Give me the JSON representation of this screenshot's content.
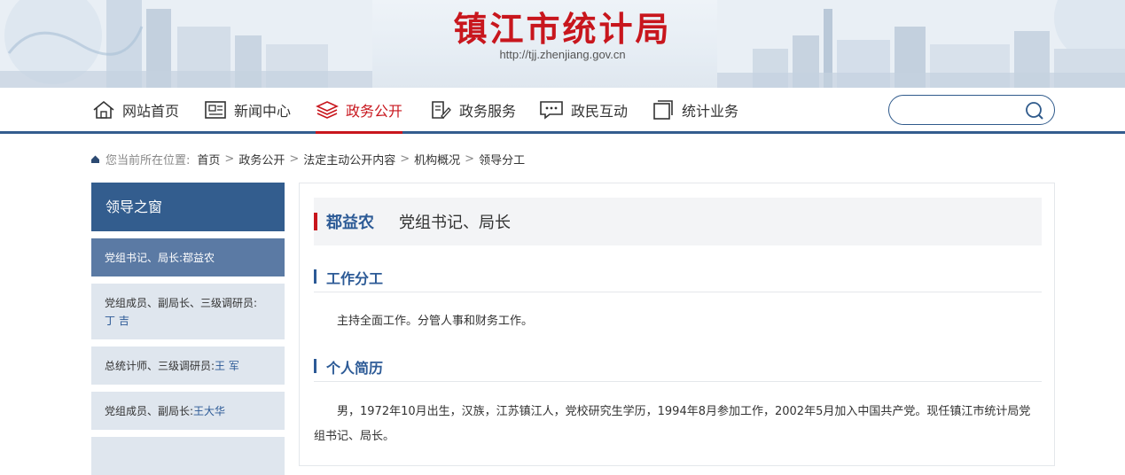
{
  "header": {
    "site_title": "镇江市统计局",
    "site_url": "http://tjj.zhenjiang.gov.cn"
  },
  "nav": {
    "items": [
      {
        "label": "网站首页",
        "icon": "home-icon"
      },
      {
        "label": "新闻中心",
        "icon": "news-icon"
      },
      {
        "label": "政务公开",
        "icon": "layers-icon",
        "active": true
      },
      {
        "label": "政务服务",
        "icon": "edit-document-icon"
      },
      {
        "label": "政民互动",
        "icon": "chat-icon"
      },
      {
        "label": "统计业务",
        "icon": "square-icon"
      }
    ],
    "search_value": "",
    "active_color": "#c8161d",
    "brand_color": "#335d8e"
  },
  "breadcrumb": {
    "label": "您当前所在位置:",
    "items": [
      "首页",
      "政务公开",
      "法定主动公开内容",
      "机构概况",
      "领导分工"
    ],
    "separator": ">"
  },
  "sidebar": {
    "title": "领导之窗",
    "items": [
      {
        "role": "党组书记、局长:",
        "name": "鄀益农"
      },
      {
        "role": "党组成员、副局长、三级调研员:",
        "name": "丁 吉"
      },
      {
        "role": "总统计师、三级调研员:",
        "name": "王 军"
      },
      {
        "role": "党组成员、副局长:",
        "name": "王大华"
      }
    ]
  },
  "main": {
    "person_name": "鄀益农",
    "person_title": "党组书记、局长",
    "sections": [
      {
        "heading": "工作分工",
        "body": "主持全面工作。分管人事和财务工作。"
      },
      {
        "heading": "个人简历",
        "body": "男，1972年10月出生，汉族，江苏镇江人，党校研究生学历，1994年8月参加工作，2002年5月加入中国共产党。现任镇江市统计局党组书记、局长。"
      }
    ]
  }
}
